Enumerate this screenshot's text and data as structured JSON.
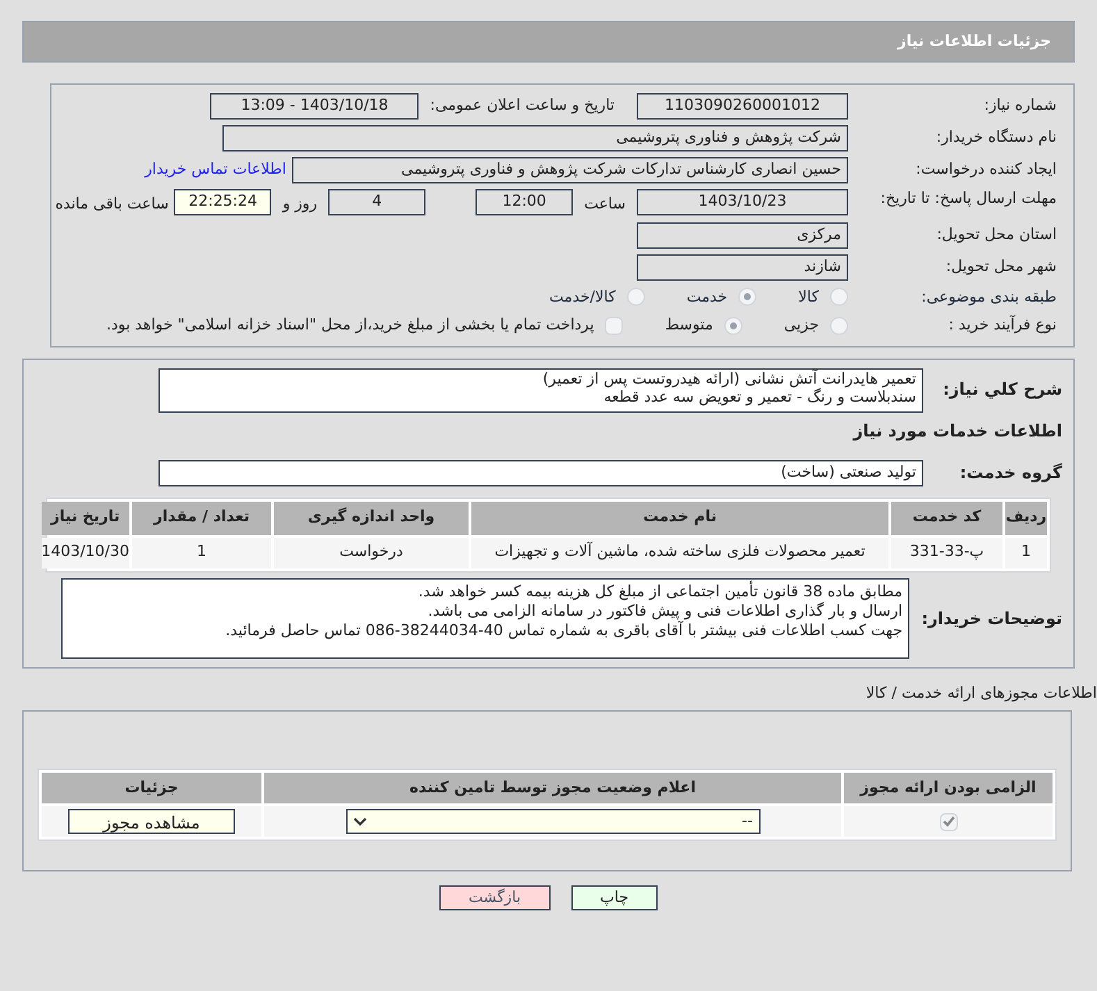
{
  "header": {
    "title": "جزئیات اطلاعات نیاز"
  },
  "fields": {
    "need_number_label": "شماره نیاز:",
    "need_number": "1103090260001012",
    "announce_label": "تاریخ و ساعت اعلان عمومی:",
    "announce": "1403/10/18 - 13:09",
    "buyer_label": "نام دستگاه خریدار:",
    "buyer": "شرکت پژوهش و فناوری پتروشیمی",
    "requester_label": "ایجاد کننده درخواست:",
    "requester": "حسین انصاری کارشناس تدارکات شرکت پژوهش و فناوری پتروشیمی",
    "contact_link": "اطلاعات تماس خریدار",
    "deadline_label": "مهلت ارسال پاسخ: تا تاریخ:",
    "deadline_date": "1403/10/23",
    "time_label": "ساعت",
    "deadline_time": "12:00",
    "days": "4",
    "days_label": "روز و",
    "remaining": "22:25:24",
    "remaining_label": "ساعت باقی مانده",
    "province_label": "استان محل تحویل:",
    "province": "مرکزی",
    "city_label": "شهر محل تحویل:",
    "city": "شازند"
  },
  "category": {
    "label": "طبقه بندی موضوعی:",
    "options": [
      {
        "label": "کالا",
        "selected": false
      },
      {
        "label": "خدمت",
        "selected": true
      },
      {
        "label": "کالا/خدمت",
        "selected": false
      }
    ]
  },
  "purchase_type": {
    "label": "نوع فرآیند خرید :",
    "options": [
      {
        "label": "جزیی",
        "selected": false
      },
      {
        "label": "متوسط",
        "selected": true
      }
    ],
    "payment_checkbox": {
      "label": "پرداخت تمام یا بخشی از مبلغ خرید،از محل \"اسناد خزانه اسلامی\" خواهد بود.",
      "checked": false
    }
  },
  "description": {
    "label": "شرح کلي نياز:",
    "lines": [
      "تعمیر هایدرانت آتش نشانی (ارائه هیدروتست پس از تعمیر)",
      "سندبلاست و رنگ - تعمیر و تعویض سه عدد قطعه"
    ]
  },
  "services_heading": "اطلاعات خدمات مورد نیاز",
  "service_group": {
    "label": "گروه خدمت:",
    "value": "تولید صنعتی (ساخت)"
  },
  "table": {
    "columns": [
      "ردیف",
      "کد خدمت",
      "نام خدمت",
      "واحد اندازه گیری",
      "تعداد / مقدار",
      "تاریخ نیاز"
    ],
    "rows": [
      [
        "1",
        "پ-33-331",
        "تعمیر محصولات فلزی ساخته شده، ماشین آلات و تجهیزات",
        "درخواست",
        "1",
        "1403/10/30"
      ]
    ]
  },
  "buyer_notes": {
    "label": "توضیحات خریدار:",
    "lines": [
      "مطابق ماده 38 قانون تأمین اجتماعی از مبلغ کل هزینه بیمه کسر خواهد شد.",
      "ارسال و بار گذاری اطلاعات فنی و پیش فاکتور در سامانه الزامی می باشد.",
      "جهت کسب اطلاعات فنی بیشتر با آقای باقری به شماره تماس  40-38244034-086 تماس حاصل فرمائید."
    ]
  },
  "permits": {
    "title": "اطلاعات مجوزهای ارائه خدمت / کالا",
    "columns": [
      "الزامی بودن ارائه مجوز",
      "اعلام وضعیت مجوز توسط تامین کننده",
      "جزئیات"
    ],
    "rows": [
      {
        "required": true,
        "status": "--",
        "details_button": "مشاهده مجوز"
      }
    ]
  },
  "buttons": [
    "چاپ",
    "بازگشت"
  ]
}
